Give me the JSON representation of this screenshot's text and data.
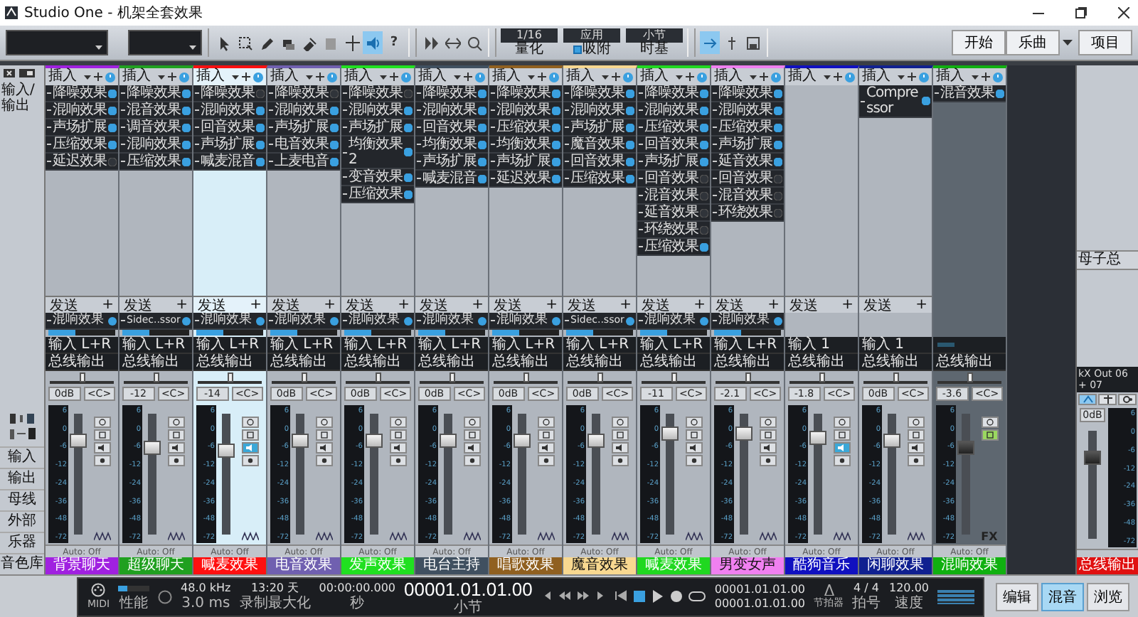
{
  "window": {
    "title": "Studio One - 机架全套效果"
  },
  "toolbar": {
    "help": "?",
    "displays": [
      {
        "kind": "plain",
        "value": "1/16",
        "label": "量化"
      },
      {
        "kind": "check",
        "value": "应用",
        "label": "吸附",
        "checked": true
      },
      {
        "kind": "plain",
        "value": "小节",
        "label": "时基"
      }
    ],
    "nav": [
      {
        "label": "开始",
        "dropdown": false
      },
      {
        "label": "乐曲",
        "dropdown": true
      },
      {
        "label": "项目",
        "dropdown": false
      }
    ]
  },
  "left_panel": {
    "header": "输入/输出",
    "items": [
      "输入",
      "输出",
      "母线",
      "外部",
      "乐器",
      "音色库"
    ]
  },
  "channels": [
    {
      "kind": "audio",
      "insert_label": "插入",
      "name": "背景聊天",
      "color": "#a020e0",
      "selected": false,
      "inserts": [
        {
          "name": "降噪效果",
          "on": true
        },
        {
          "name": "混响效果",
          "on": true
        },
        {
          "name": "声场扩展",
          "on": true
        },
        {
          "name": "压缩效果",
          "on": true
        },
        {
          "name": "延迟效果",
          "on": false
        }
      ],
      "send_label": "发送",
      "send_add": "+",
      "send": "混响效果",
      "input": "输入 L+R",
      "output": "总线输出",
      "volume": "0dB",
      "pan": "<C>",
      "meter_scale": [
        "6",
        "0",
        "-6",
        "-12",
        "-24",
        "-36",
        "-48",
        "-72"
      ],
      "level": 0.78,
      "monitor": false,
      "solo": false,
      "automation": "Auto: Off"
    },
    {
      "kind": "audio",
      "insert_label": "插入",
      "name": "超级聊天",
      "color": "#20a020",
      "selected": false,
      "inserts": [
        {
          "name": "降噪效果",
          "on": true
        },
        {
          "name": "混音效果",
          "on": true
        },
        {
          "name": "调音效果",
          "on": true
        },
        {
          "name": "混响效果",
          "on": true
        },
        {
          "name": "压缩效果",
          "on": true
        }
      ],
      "send_label": "发送",
      "send_add": "+",
      "send": "Sidec..ssor",
      "input": "输入 L+R",
      "output": "总线输出",
      "volume": "-12",
      "pan": "<C>",
      "meter_scale": [
        "6",
        "0",
        "-6",
        "-12",
        "-24",
        "-36",
        "-48",
        "-72"
      ],
      "level": 0.72,
      "monitor": false,
      "solo": false,
      "automation": "Auto: Off"
    },
    {
      "kind": "audio",
      "insert_label": "插入",
      "name": "喊麦效果",
      "color": "#ff1010",
      "selected": true,
      "inserts": [
        {
          "name": "降噪效果",
          "on": false
        },
        {
          "name": "混响效果",
          "on": true
        },
        {
          "name": "回音效果",
          "on": true
        },
        {
          "name": "声场扩展",
          "on": true
        },
        {
          "name": "喊麦混音",
          "on": true
        }
      ],
      "send_label": "发送",
      "send_add": "+",
      "send": "混响效果",
      "input": "输入 L+R",
      "output": "总线输出",
      "volume": "-14",
      "pan": "<C>",
      "meter_scale": [
        "6",
        "0",
        "-6",
        "-12",
        "-24",
        "-36",
        "-48",
        "-72"
      ],
      "level": 0.7,
      "monitor": true,
      "solo": false,
      "automation": "Auto: Off"
    },
    {
      "kind": "audio",
      "insert_label": "插入",
      "name": "电音效果",
      "color": "#7060b0",
      "selected": false,
      "inserts": [
        {
          "name": "降噪效果",
          "on": false
        },
        {
          "name": "混响效果",
          "on": true
        },
        {
          "name": "声场扩展",
          "on": true
        },
        {
          "name": "电音效果",
          "on": true
        },
        {
          "name": "上麦电音",
          "on": true
        }
      ],
      "send_label": "发送",
      "send_add": "+",
      "send": "混响效果",
      "input": "输入 L+R",
      "output": "总线输出",
      "volume": "0dB",
      "pan": "<C>",
      "meter_scale": [
        "6",
        "0",
        "-6",
        "-12",
        "-24",
        "-36",
        "-48",
        "-72"
      ],
      "level": 0.78,
      "monitor": false,
      "solo": false,
      "automation": "Auto: Off"
    },
    {
      "kind": "audio",
      "insert_label": "插入",
      "name": "发声效果",
      "color": "#20e020",
      "selected": false,
      "inserts": [
        {
          "name": "降噪效果",
          "on": false
        },
        {
          "name": "混响效果",
          "on": true
        },
        {
          "name": "声场扩展",
          "on": true
        },
        {
          "name": "均衡效果 2",
          "on": true
        },
        {
          "name": "变音效果",
          "on": true
        },
        {
          "name": "压缩效果",
          "on": true
        }
      ],
      "send_label": "发送",
      "send_add": "+",
      "send": "混响效果",
      "input": "输入 L+R",
      "output": "总线输出",
      "volume": "0dB",
      "pan": "<C>",
      "meter_scale": [
        "6",
        "0",
        "-6",
        "-12",
        "-24",
        "-36",
        "-48",
        "-72"
      ],
      "level": 0.78,
      "monitor": false,
      "solo": false,
      "automation": "Auto: Off"
    },
    {
      "kind": "audio",
      "insert_label": "插入",
      "name": "电台主持",
      "color": "#405060",
      "selected": false,
      "inserts": [
        {
          "name": "降噪效果",
          "on": true
        },
        {
          "name": "混响效果",
          "on": true
        },
        {
          "name": "回音效果",
          "on": true
        },
        {
          "name": "均衡效果",
          "on": true
        },
        {
          "name": "声场扩展",
          "on": true
        },
        {
          "name": "喊麦混音",
          "on": true
        }
      ],
      "send_label": "发送",
      "send_add": "+",
      "send": "混响效果",
      "input": "输入 L+R",
      "output": "总线输出",
      "volume": "0dB",
      "pan": "<C>",
      "meter_scale": [
        "6",
        "0",
        "-6",
        "-12",
        "-24",
        "-36",
        "-48",
        "-72"
      ],
      "level": 0.78,
      "monitor": false,
      "solo": false,
      "automation": "Auto: Off"
    },
    {
      "kind": "audio",
      "insert_label": "插入",
      "name": "唱歌效果",
      "color": "#906020",
      "selected": false,
      "inserts": [
        {
          "name": "降噪效果",
          "on": true
        },
        {
          "name": "混响效果",
          "on": true
        },
        {
          "name": "压缩效果",
          "on": true
        },
        {
          "name": "均衡效果",
          "on": true
        },
        {
          "name": "声场扩展",
          "on": true
        },
        {
          "name": "延迟效果",
          "on": true
        }
      ],
      "send_label": "发送",
      "send_add": "+",
      "send": "混响效果",
      "input": "输入 L+R",
      "output": "总线输出",
      "volume": "0dB",
      "pan": "<C>",
      "meter_scale": [
        "6",
        "0",
        "-6",
        "-12",
        "-24",
        "-36",
        "-48",
        "-72"
      ],
      "level": 0.78,
      "monitor": false,
      "solo": false,
      "automation": "Auto: Off"
    },
    {
      "kind": "audio",
      "insert_label": "插入",
      "name": "魔音效果",
      "color": "#f8d890",
      "selected": false,
      "inserts": [
        {
          "name": "降噪效果",
          "on": true
        },
        {
          "name": "混响效果",
          "on": true
        },
        {
          "name": "声场扩展",
          "on": true
        },
        {
          "name": "魔音效果",
          "on": true
        },
        {
          "name": "回音效果",
          "on": true
        },
        {
          "name": "压缩效果",
          "on": true
        }
      ],
      "send_label": "发送",
      "send_add": "+",
      "send": "Sidec..ssor",
      "input": "输入 L+R",
      "output": "总线输出",
      "volume": "0dB",
      "pan": "<C>",
      "meter_scale": [
        "6",
        "0",
        "-6",
        "-12",
        "-24",
        "-36",
        "-48",
        "-72"
      ],
      "level": 0.78,
      "monitor": false,
      "solo": false,
      "automation": "Auto: Off"
    },
    {
      "kind": "audio",
      "insert_label": "插入",
      "name": "喊麦效果",
      "color": "#20d820",
      "selected": false,
      "inserts": [
        {
          "name": "降噪效果",
          "on": true
        },
        {
          "name": "混响效果",
          "on": true
        },
        {
          "name": "压缩效果",
          "on": true
        },
        {
          "name": "回音效果",
          "on": true
        },
        {
          "name": "声场扩展",
          "on": true
        },
        {
          "name": "回音效果",
          "on": false
        },
        {
          "name": "混音效果",
          "on": false
        },
        {
          "name": "延音效果",
          "on": false
        },
        {
          "name": "环绕效果",
          "on": false
        },
        {
          "name": "压缩效果",
          "on": true
        }
      ],
      "send_label": "发送",
      "send_add": "+",
      "send": "混响效果",
      "input": "输入 L+R",
      "output": "总线输出",
      "volume": "-11",
      "pan": "<C>",
      "meter_scale": [
        "6",
        "0",
        "-6",
        "-12",
        "-24",
        "-36",
        "-48",
        "-72"
      ],
      "level": 0.84,
      "monitor": false,
      "solo": false,
      "automation": "Auto: Off"
    },
    {
      "kind": "audio",
      "insert_label": "插入",
      "name": "男变女声",
      "color": "#f080f0",
      "selected": false,
      "inserts": [
        {
          "name": "降噪效果",
          "on": true
        },
        {
          "name": "混响效果",
          "on": true
        },
        {
          "name": "压缩效果",
          "on": true
        },
        {
          "name": "声场扩展",
          "on": true
        },
        {
          "name": "延音效果",
          "on": true
        },
        {
          "name": "回音效果",
          "on": false
        },
        {
          "name": "混音效果",
          "on": false
        },
        {
          "name": "环绕效果",
          "on": false
        }
      ],
      "send_label": "发送",
      "send_add": "+",
      "send": "混响效果",
      "input": "输入 L+R",
      "output": "总线输出",
      "volume": "-2.1",
      "pan": "<C>",
      "meter_scale": [
        "6",
        "0",
        "-6",
        "-12",
        "-24",
        "-36",
        "-48",
        "-72"
      ],
      "level": 0.84,
      "monitor": false,
      "solo": false,
      "automation": "Auto: Off"
    },
    {
      "kind": "audio",
      "insert_label": "插入",
      "name": "酷狗音乐",
      "color": "#1010c0",
      "selected": false,
      "send_label": "发送",
      "send_add": "+",
      "input": "输入 1",
      "output": "总线输出",
      "volume": "-1.8",
      "pan": "<C>",
      "meter_scale": [
        "6",
        "0",
        "-6",
        "-12",
        "-24",
        "-36",
        "-48",
        "-72"
      ],
      "level": 0.8,
      "monitor": true,
      "solo": false,
      "automation": "Auto: Off"
    },
    {
      "kind": "audio",
      "insert_label": "插入",
      "name": "闲聊效果",
      "color": "#102090",
      "selected": false,
      "inserts": [
        {
          "name": "Compressor",
          "on": true
        }
      ],
      "send_label": "发送",
      "send_add": "+",
      "input": "输入 1",
      "output": "总线输出",
      "volume": "0dB",
      "pan": "<C>",
      "meter_scale": [
        "6",
        "0",
        "-6",
        "-12",
        "-24",
        "-36",
        "-48",
        "-72"
      ],
      "level": 0.78,
      "monitor": false,
      "solo": false,
      "automation": "Auto: Off"
    },
    {
      "kind": "fx",
      "insert_label": "插入",
      "name": "混响效果",
      "color": "#10b010",
      "selected": false,
      "inserts": [
        {
          "name": "混音效果",
          "on": true
        }
      ],
      "output": "总线输出",
      "volume": "-3.6",
      "pan": "<C>",
      "meter_scale": [
        "6",
        "0",
        "-6",
        "-12",
        "-24",
        "-36",
        "-48",
        "-72"
      ],
      "level": 0.72,
      "solo": true,
      "badge": "FX",
      "automation": "Auto: Off"
    }
  ],
  "main_bus": {
    "group": "母子总",
    "output": "kX Out 06 + 07",
    "volume": "0dB",
    "meter_scale": [
      "6",
      "0",
      "-6",
      "-12",
      "-24",
      "-36",
      "-48",
      "-72"
    ],
    "name": "总线输出",
    "color": "#e01010",
    "level": 0.75
  },
  "transport": {
    "midi": "MIDI",
    "performance": "性能",
    "rate": "48.0 kHz",
    "latency": "3.0 ms",
    "record_time": "13:20 天",
    "record_label": "录制最大化",
    "seconds": "00:00:00.000",
    "seconds_label": "秒",
    "bars": "00001.01.01.00",
    "bars_label": "小节",
    "loop_start": "00001.01.01.00",
    "loop_end": "00001.01.01.00",
    "metronome": "节拍器",
    "signature": "4 / 4",
    "signature_label": "拍号",
    "tempo": "120.00",
    "tempo_label": "速度"
  },
  "views": [
    {
      "label": "编辑",
      "selected": false
    },
    {
      "label": "混音",
      "selected": true
    },
    {
      "label": "浏览",
      "selected": false
    }
  ]
}
